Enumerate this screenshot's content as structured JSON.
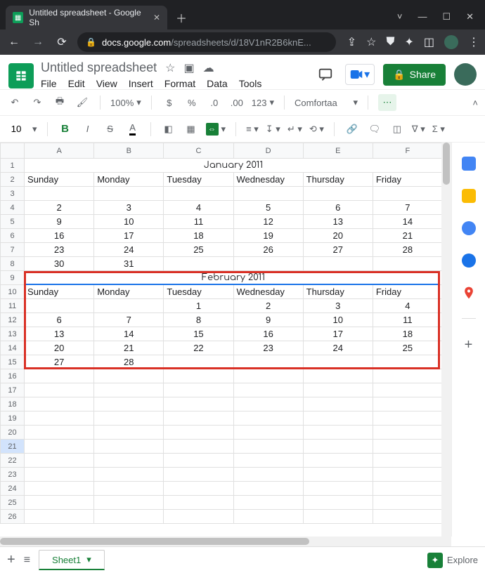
{
  "browser": {
    "tab_title": "Untitled spreadsheet - Google Sh",
    "url_domain": "docs.google.com",
    "url_path": "/spreadsheets/d/18V1nR2B6knE..."
  },
  "doc": {
    "title": "Untitled spreadsheet",
    "menus": [
      "File",
      "Edit",
      "View",
      "Insert",
      "Format",
      "Data",
      "Tools"
    ],
    "share_label": "Share"
  },
  "toolbar": {
    "zoom": "100%",
    "font": "Comfortaa",
    "font_size": "10",
    "num_format": "123"
  },
  "columns": [
    "",
    "A",
    "B",
    "C",
    "D",
    "E",
    "F"
  ],
  "selected_row": 21,
  "sheet_tab": "Sheet1",
  "explore_label": "Explore",
  "month1_title": "January 2011",
  "month2_title": "February 2011",
  "days": [
    "Sunday",
    "Monday",
    "Tuesday",
    "Wednesday",
    "Thursday",
    "Friday"
  ],
  "jan_rows": [
    [
      "",
      "",
      "",
      "",
      "",
      ""
    ],
    [
      "2",
      "3",
      "4",
      "5",
      "6",
      "7"
    ],
    [
      "9",
      "10",
      "11",
      "12",
      "13",
      "14"
    ],
    [
      "16",
      "17",
      "18",
      "19",
      "20",
      "21"
    ],
    [
      "23",
      "24",
      "25",
      "26",
      "27",
      "28"
    ],
    [
      "30",
      "31",
      "",
      "",
      "",
      ""
    ]
  ],
  "feb_rows": [
    [
      "",
      "",
      "1",
      "2",
      "3",
      "4"
    ],
    [
      "6",
      "7",
      "8",
      "9",
      "10",
      "11"
    ],
    [
      "13",
      "14",
      "15",
      "16",
      "17",
      "18"
    ],
    [
      "20",
      "21",
      "22",
      "23",
      "24",
      "25"
    ],
    [
      "27",
      "28",
      "",
      "",
      "",
      ""
    ]
  ],
  "row_count": 26
}
